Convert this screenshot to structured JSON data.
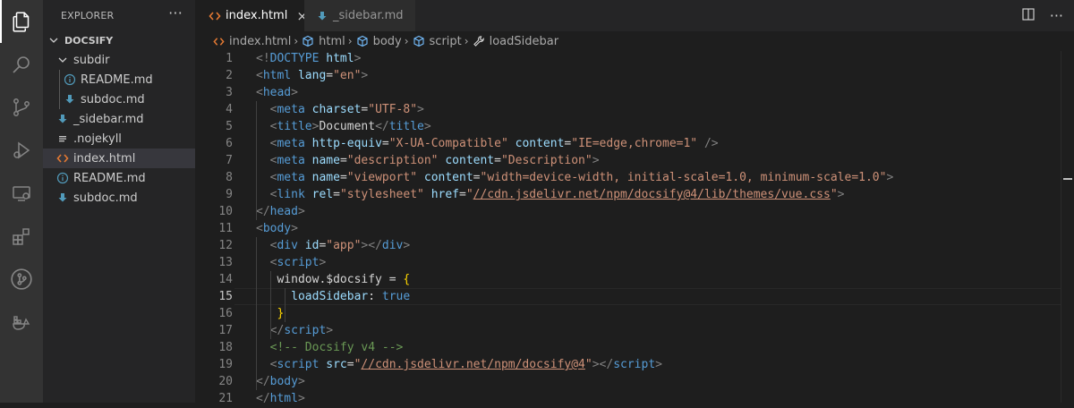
{
  "explorer": {
    "title": "EXPLORER",
    "more_label": "···",
    "root": "DOCSIFY",
    "items": [
      {
        "label": "subdir",
        "kind": "folder"
      },
      {
        "label": "README.md",
        "kind": "readme"
      },
      {
        "label": "subdoc.md",
        "kind": "md"
      },
      {
        "label": "_sidebar.md",
        "kind": "md"
      },
      {
        "label": ".nojekyll",
        "kind": "text"
      },
      {
        "label": "index.html",
        "kind": "html"
      },
      {
        "label": "README.md",
        "kind": "readme"
      },
      {
        "label": "subdoc.md",
        "kind": "md"
      }
    ]
  },
  "tabs": [
    {
      "label": "index.html",
      "close": "×"
    },
    {
      "label": "_sidebar.md"
    }
  ],
  "breadcrumbs": [
    "index.html",
    "html",
    "body",
    "script",
    "loadSidebar"
  ],
  "editor": {
    "current_line": 15,
    "lines": [
      [
        [
          "tag",
          "<!"
        ],
        [
          "name",
          "DOCTYPE"
        ],
        [
          "txt",
          " "
        ],
        [
          "attr",
          "html"
        ],
        [
          "tag",
          ">"
        ]
      ],
      [
        [
          "tag",
          "<"
        ],
        [
          "name",
          "html"
        ],
        [
          "txt",
          " "
        ],
        [
          "attr",
          "lang"
        ],
        [
          "txt",
          "="
        ],
        [
          "str",
          "\"en\""
        ],
        [
          "tag",
          ">"
        ]
      ],
      [
        [
          "tag",
          "<"
        ],
        [
          "name",
          "head"
        ],
        [
          "tag",
          ">"
        ]
      ],
      [
        [
          "txt",
          "  "
        ],
        [
          "tag",
          "<"
        ],
        [
          "name",
          "meta"
        ],
        [
          "txt",
          " "
        ],
        [
          "attr",
          "charset"
        ],
        [
          "txt",
          "="
        ],
        [
          "str",
          "\"UTF-8\""
        ],
        [
          "tag",
          ">"
        ]
      ],
      [
        [
          "txt",
          "  "
        ],
        [
          "tag",
          "<"
        ],
        [
          "name",
          "title"
        ],
        [
          "tag",
          ">"
        ],
        [
          "txt",
          "Document"
        ],
        [
          "tag",
          "</"
        ],
        [
          "name",
          "title"
        ],
        [
          "tag",
          ">"
        ]
      ],
      [
        [
          "txt",
          "  "
        ],
        [
          "tag",
          "<"
        ],
        [
          "name",
          "meta"
        ],
        [
          "txt",
          " "
        ],
        [
          "attr",
          "http-equiv"
        ],
        [
          "txt",
          "="
        ],
        [
          "str",
          "\"X-UA-Compatible\""
        ],
        [
          "txt",
          " "
        ],
        [
          "attr",
          "content"
        ],
        [
          "txt",
          "="
        ],
        [
          "str",
          "\"IE=edge,chrome=1\""
        ],
        [
          "txt",
          " "
        ],
        [
          "tag",
          "/>"
        ]
      ],
      [
        [
          "txt",
          "  "
        ],
        [
          "tag",
          "<"
        ],
        [
          "name",
          "meta"
        ],
        [
          "txt",
          " "
        ],
        [
          "attr",
          "name"
        ],
        [
          "txt",
          "="
        ],
        [
          "str",
          "\"description\""
        ],
        [
          "txt",
          " "
        ],
        [
          "attr",
          "content"
        ],
        [
          "txt",
          "="
        ],
        [
          "str",
          "\"Description\""
        ],
        [
          "tag",
          ">"
        ]
      ],
      [
        [
          "txt",
          "  "
        ],
        [
          "tag",
          "<"
        ],
        [
          "name",
          "meta"
        ],
        [
          "txt",
          " "
        ],
        [
          "attr",
          "name"
        ],
        [
          "txt",
          "="
        ],
        [
          "str",
          "\"viewport\""
        ],
        [
          "txt",
          " "
        ],
        [
          "attr",
          "content"
        ],
        [
          "txt",
          "="
        ],
        [
          "str",
          "\"width=device-width, initial-scale=1.0, minimum-scale=1.0\""
        ],
        [
          "tag",
          ">"
        ]
      ],
      [
        [
          "txt",
          "  "
        ],
        [
          "tag",
          "<"
        ],
        [
          "name",
          "link"
        ],
        [
          "txt",
          " "
        ],
        [
          "attr",
          "rel"
        ],
        [
          "txt",
          "="
        ],
        [
          "str",
          "\"stylesheet\""
        ],
        [
          "txt",
          " "
        ],
        [
          "attr",
          "href"
        ],
        [
          "txt",
          "="
        ],
        [
          "str",
          "\""
        ],
        [
          "url",
          "//cdn.jsdelivr.net/npm/docsify@4/lib/themes/vue.css"
        ],
        [
          "str",
          "\""
        ],
        [
          "tag",
          ">"
        ]
      ],
      [
        [
          "tag",
          "</"
        ],
        [
          "name",
          "head"
        ],
        [
          "tag",
          ">"
        ]
      ],
      [
        [
          "tag",
          "<"
        ],
        [
          "name",
          "body"
        ],
        [
          "tag",
          ">"
        ]
      ],
      [
        [
          "txt",
          "  "
        ],
        [
          "tag",
          "<"
        ],
        [
          "name",
          "div"
        ],
        [
          "txt",
          " "
        ],
        [
          "attr",
          "id"
        ],
        [
          "txt",
          "="
        ],
        [
          "str",
          "\"app\""
        ],
        [
          "tag",
          "></"
        ],
        [
          "name",
          "div"
        ],
        [
          "tag",
          ">"
        ]
      ],
      [
        [
          "txt",
          "  "
        ],
        [
          "tag",
          "<"
        ],
        [
          "name",
          "script"
        ],
        [
          "tag",
          ">"
        ]
      ],
      [
        [
          "txt",
          "   "
        ],
        [
          "plain",
          "window.$docsify = "
        ],
        [
          "brace",
          "{"
        ]
      ],
      [
        [
          "txt",
          "     "
        ],
        [
          "var",
          "loadSidebar"
        ],
        [
          "plain",
          ": "
        ],
        [
          "kw",
          "true"
        ]
      ],
      [
        [
          "txt",
          "   "
        ],
        [
          "brace",
          "}"
        ]
      ],
      [
        [
          "txt",
          "  "
        ],
        [
          "tag",
          "</"
        ],
        [
          "name",
          "script"
        ],
        [
          "tag",
          ">"
        ]
      ],
      [
        [
          "txt",
          "  "
        ],
        [
          "com",
          "<!-- Docsify v4 -->"
        ]
      ],
      [
        [
          "txt",
          "  "
        ],
        [
          "tag",
          "<"
        ],
        [
          "name",
          "script"
        ],
        [
          "txt",
          " "
        ],
        [
          "attr",
          "src"
        ],
        [
          "txt",
          "="
        ],
        [
          "str",
          "\""
        ],
        [
          "url",
          "//cdn.jsdelivr.net/npm/docsify@4"
        ],
        [
          "str",
          "\""
        ],
        [
          "tag",
          "></"
        ],
        [
          "name",
          "script"
        ],
        [
          "tag",
          ">"
        ]
      ],
      [
        [
          "tag",
          "</"
        ],
        [
          "name",
          "body"
        ],
        [
          "tag",
          ">"
        ]
      ],
      [
        [
          "tag",
          "</"
        ],
        [
          "name",
          "html"
        ],
        [
          "tag",
          ">"
        ]
      ]
    ]
  }
}
